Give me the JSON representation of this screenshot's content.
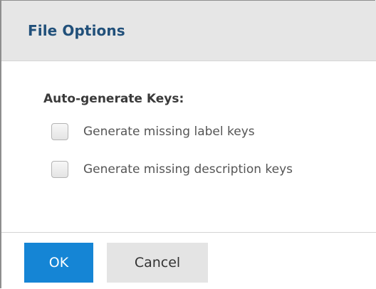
{
  "dialog": {
    "title": "File Options",
    "section_title": "Auto-generate Keys:",
    "options": [
      {
        "label": "Generate missing label keys",
        "checked": false
      },
      {
        "label": "Generate missing description keys",
        "checked": false
      }
    ],
    "buttons": {
      "ok_label": "OK",
      "cancel_label": "Cancel"
    },
    "colors": {
      "title": "#21507a",
      "header_bg": "#e6e6e6",
      "primary_button": "#1585d5",
      "secondary_button": "#e4e4e4"
    }
  }
}
